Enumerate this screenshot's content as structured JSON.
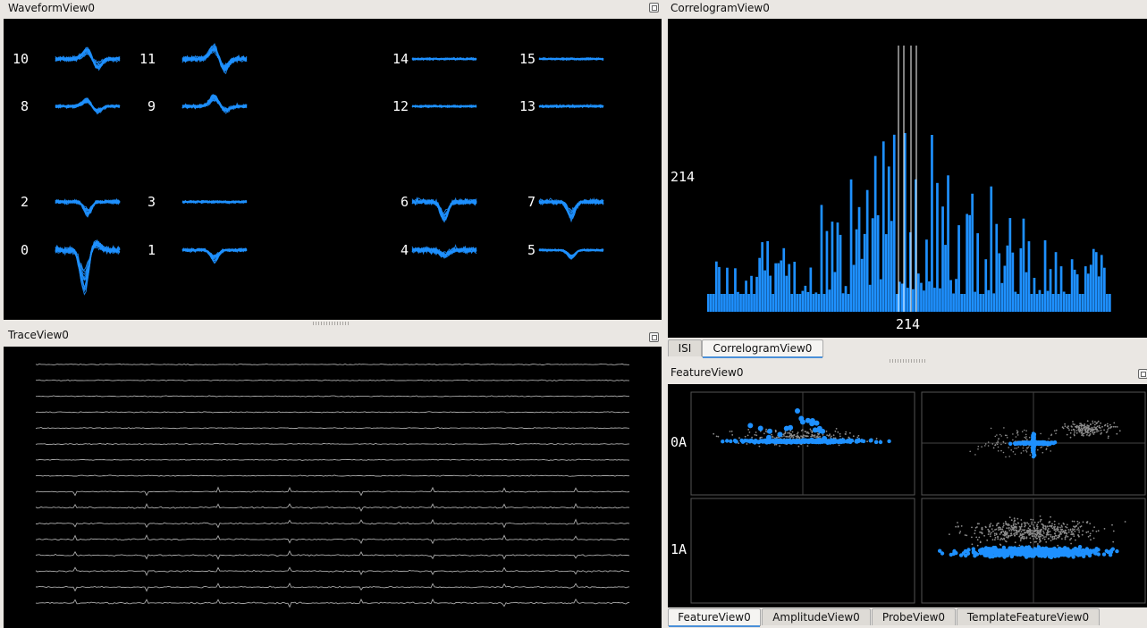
{
  "waveform": {
    "title": "WaveformView0",
    "channels": [
      {
        "label": "10",
        "kind": "biphasic",
        "amp": 1.0
      },
      {
        "label": "11",
        "kind": "biphasic",
        "amp": 1.3
      },
      {
        "label": "14",
        "kind": "flat",
        "amp": 0.5
      },
      {
        "label": "15",
        "kind": "flat",
        "amp": 0.5
      },
      {
        "label": "8",
        "kind": "biphasic",
        "amp": 0.7
      },
      {
        "label": "9",
        "kind": "peak",
        "amp": 0.9
      },
      {
        "label": "12",
        "kind": "flat",
        "amp": 0.5
      },
      {
        "label": "13",
        "kind": "flat",
        "amp": 0.6
      },
      {
        "label": "2",
        "kind": "dip",
        "amp": 0.9
      },
      {
        "label": "3",
        "kind": "flat",
        "amp": 0.6
      },
      {
        "label": "6",
        "kind": "dip",
        "amp": 1.3
      },
      {
        "label": "7",
        "kind": "dip",
        "amp": 1.1
      },
      {
        "label": "0",
        "kind": "bigdip",
        "amp": 1.6
      },
      {
        "label": "1",
        "kind": "dip",
        "amp": 0.7
      },
      {
        "label": "4",
        "kind": "noisy",
        "amp": 0.9
      },
      {
        "label": "5",
        "kind": "dip",
        "amp": 0.5
      }
    ],
    "trace_color": "#1e90ff"
  },
  "correlogram": {
    "title": "CorrelogramView0",
    "y_label": "214",
    "x_label": "214",
    "bar_color": "#1e90ff",
    "tabs": [
      "ISI",
      "CorrelogramView0"
    ],
    "active_tab": 1
  },
  "trace": {
    "title": "TraceView0",
    "channel_count": 16,
    "trace_color": "#a8a8a8"
  },
  "feature": {
    "title": "FeatureView0",
    "row_labels": [
      "0A",
      "1A"
    ],
    "point_color": "#1e90ff",
    "background_points_color": "#8c8c8c",
    "tabs": [
      "FeatureView0",
      "AmplitudeView0",
      "ProbeView0",
      "TemplateFeatureView0"
    ],
    "active_tab": 0
  }
}
